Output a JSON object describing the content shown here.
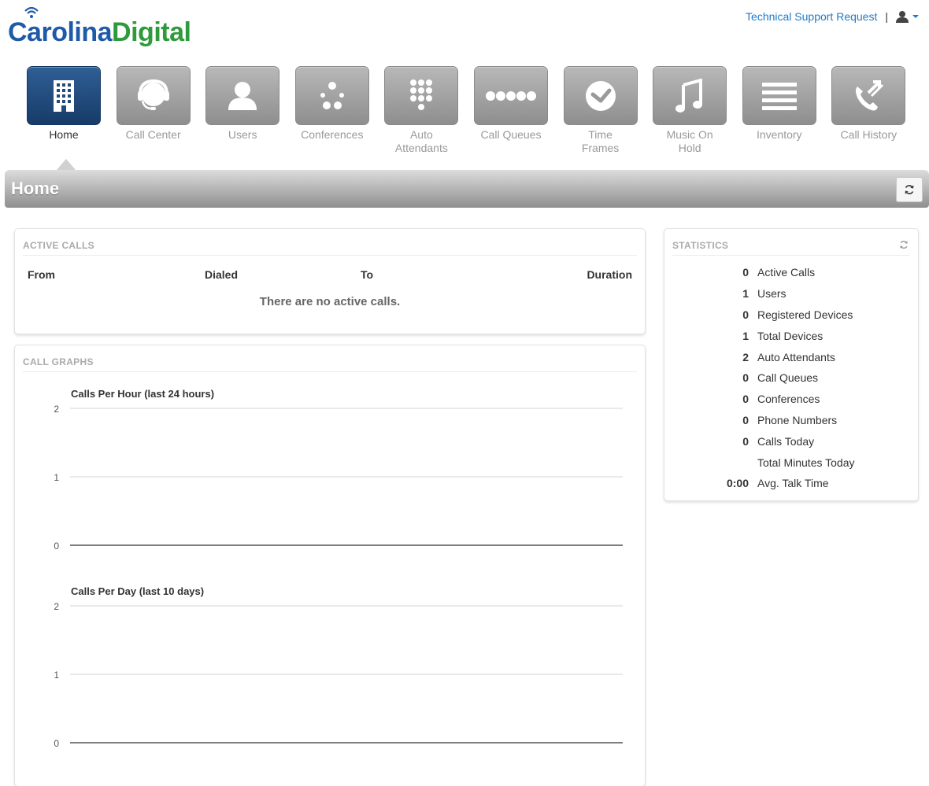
{
  "brand": {
    "part1": "Carolina",
    "part2": "Digital"
  },
  "header": {
    "support_link": "Technical Support Request",
    "separator": "|",
    "user_icon": "user-icon",
    "caret_icon": "caret-down-icon"
  },
  "nav": [
    {
      "label": "Home",
      "icon": "building-icon",
      "active": true
    },
    {
      "label": "Call Center",
      "icon": "headset-icon"
    },
    {
      "label": "Users",
      "icon": "user-icon"
    },
    {
      "label": "Conferences",
      "icon": "conference-dots-icon"
    },
    {
      "label": "Auto Attendants",
      "icon": "keypad-icon"
    },
    {
      "label": "Call Queues",
      "icon": "queue-dots-icon"
    },
    {
      "label": "Time Frames",
      "icon": "clock-check-icon"
    },
    {
      "label": "Music On Hold",
      "icon": "music-note-icon"
    },
    {
      "label": "Inventory",
      "icon": "list-icon"
    },
    {
      "label": "Call History",
      "icon": "phone-history-icon"
    }
  ],
  "page": {
    "title": "Home",
    "refresh_icon": "refresh-icon"
  },
  "active_calls": {
    "title": "ACTIVE CALLS",
    "columns": [
      "From",
      "Dialed",
      "To",
      "Duration"
    ],
    "empty_message": "There are no active calls."
  },
  "call_graphs": {
    "title": "CALL GRAPHS"
  },
  "chart_data": [
    {
      "type": "line",
      "title": "Calls Per Hour (last 24 hours)",
      "y_ticks": [
        0,
        1,
        2
      ],
      "ylim": [
        0,
        2
      ],
      "series": []
    },
    {
      "type": "line",
      "title": "Calls Per Day (last 10 days)",
      "y_ticks": [
        0,
        1,
        2
      ],
      "ylim": [
        0,
        2
      ],
      "series": []
    }
  ],
  "statistics": {
    "title": "STATISTICS",
    "rows": [
      {
        "value": "0",
        "label": "Active Calls"
      },
      {
        "value": "1",
        "label": "Users"
      },
      {
        "value": "0",
        "label": "Registered Devices"
      },
      {
        "value": "1",
        "label": "Total Devices"
      },
      {
        "value": "2",
        "label": "Auto Attendants"
      },
      {
        "value": "0",
        "label": "Call Queues"
      },
      {
        "value": "0",
        "label": "Conferences"
      },
      {
        "value": "0",
        "label": "Phone Numbers"
      },
      {
        "value": "0",
        "label": "Calls Today"
      },
      {
        "value": "",
        "label": "Total Minutes Today"
      },
      {
        "value": "0:00",
        "label": "Avg. Talk Time"
      }
    ]
  },
  "colors": {
    "brand_blue": "#1e5aa8",
    "brand_green": "#2e9a3c",
    "link": "#1e7ac8",
    "active_tile": "#1f4a7c"
  }
}
